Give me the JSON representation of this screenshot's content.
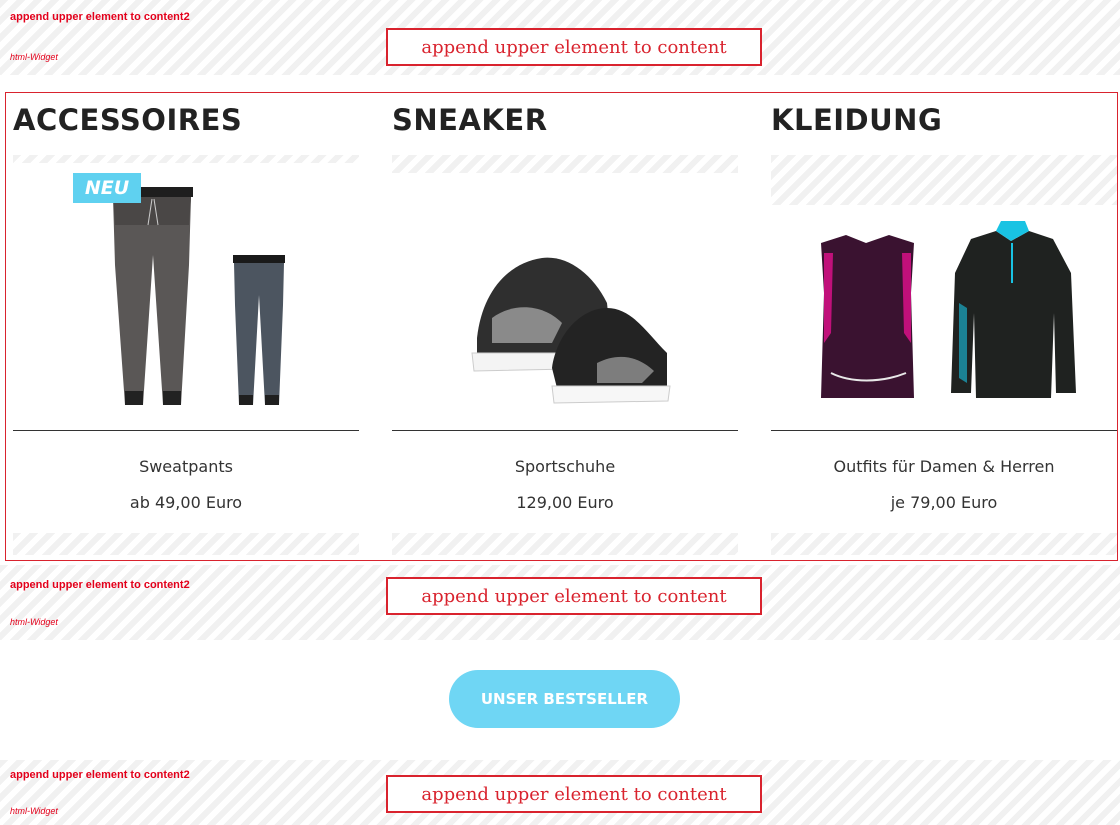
{
  "widgets": [
    {
      "content2": "append upper element to content2",
      "label": "html-Widget",
      "content": "append upper element to content"
    },
    {
      "content2": "append upper element to content2",
      "label": "html-Widget",
      "content": "append upper element to content"
    },
    {
      "content2": "append upper element to content2",
      "label": "html-Widget",
      "content": "append upper element to content"
    }
  ],
  "categories": [
    {
      "title": "ACCESSOIRES",
      "badge": "NEU",
      "product": "Sweatpants",
      "price": "ab 49,00 Euro",
      "image_icon": "sweatpants-icon"
    },
    {
      "title": "SNEAKER",
      "product": "Sportschuhe",
      "price": "129,00 Euro",
      "image_icon": "sneaker-icon"
    },
    {
      "title": "KLEIDUNG",
      "product": "Outfits für Damen & Herren",
      "price": "je 79,00 Euro",
      "image_icon": "outfit-icon"
    }
  ],
  "bestseller_label": "UNSER BESTSELLER",
  "colors": {
    "accent": "#6fd6f4",
    "widget_red": "#d9232e",
    "text": "#333333"
  }
}
